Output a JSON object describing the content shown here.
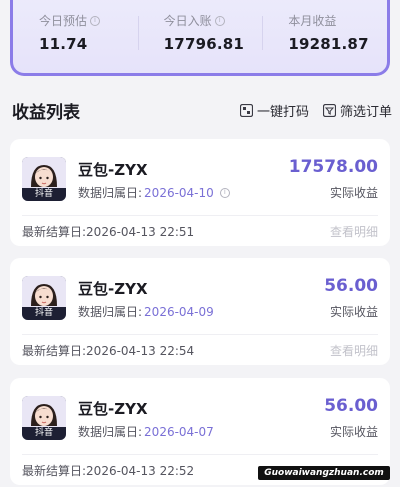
{
  "summary": {
    "today_estimate": {
      "label": "今日预估",
      "value": "11.74"
    },
    "today_income": {
      "label": "今日入账",
      "value": "17796.81"
    },
    "month_income": {
      "label": "本月收益",
      "value": "19281.87"
    }
  },
  "list": {
    "title": "收益列表",
    "action_one_click": "一键打码",
    "action_filter": "筛选订单"
  },
  "cards": [
    {
      "name": "豆包-ZYX",
      "date_label": "数据归属日:",
      "date": "2026-04-10",
      "amount": "17578.00",
      "amount_label": "实际收益",
      "settle": "最新结算日:2026-04-13 22:51",
      "detail": "查看明细",
      "platform": "抖音"
    },
    {
      "name": "豆包-ZYX",
      "date_label": "数据归属日:",
      "date": "2026-04-09",
      "amount": "56.00",
      "amount_label": "实际收益",
      "settle": "最新结算日:2026-04-13 22:54",
      "detail": "查看明细",
      "platform": "抖音"
    },
    {
      "name": "豆包-ZYX",
      "date_label": "数据归属日:",
      "date": "2026-04-07",
      "amount": "56.00",
      "amount_label": "实际收益",
      "settle": "最新结算日:2026-04-13 22:52",
      "detail": "查看明细",
      "platform": "抖音"
    }
  ],
  "watermark": "Guowaiwangzhuan.com",
  "colors": {
    "accent": "#6a5fd0",
    "border": "#8b7ce8",
    "date": "#7a70d6"
  },
  "icons": {
    "info": "info-circle-icon",
    "one_click": "mosaic-icon",
    "filter": "filter-icon",
    "avatar": "cartoon-girl-avatar"
  }
}
